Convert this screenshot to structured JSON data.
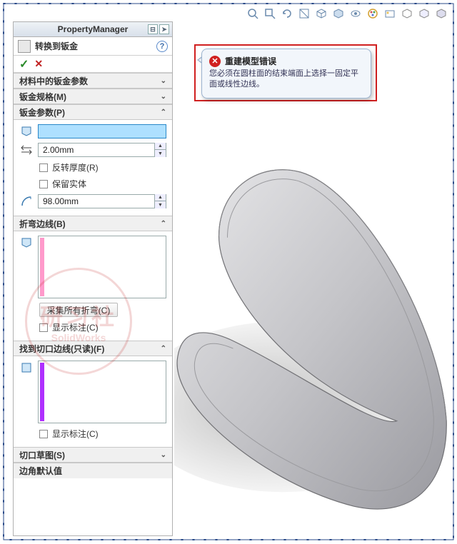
{
  "pm_title": "PropertyManager",
  "feature": {
    "title": "转换到钣金"
  },
  "buttons": {
    "ok": "✓",
    "cancel": "✕",
    "help": "?"
  },
  "sections": {
    "material": {
      "title": "材料中的钣金参数",
      "chev": "⌄"
    },
    "spec": {
      "title": "钣金规格(M)",
      "chev": "⌄"
    },
    "params": {
      "title": "钣金参数(P)",
      "chev": "⌃",
      "thickness": "2.00mm",
      "chk_reverse": "反转厚度(R)",
      "chk_keep": "保留实体",
      "radius": "98.00mm"
    },
    "bend": {
      "title": "折弯边线(B)",
      "chev": "⌃",
      "collect_btn": "采集所有折弯(C)",
      "chk_callout": "显示标注(C)"
    },
    "rip": {
      "title": "找到切口边线(只读)(F)",
      "chev": "⌃",
      "chk_callout": "显示标注(C)"
    },
    "sketch": {
      "title": "切口草图(S)",
      "chev": "⌄"
    },
    "corner": {
      "title": "边角默认值"
    }
  },
  "warning": {
    "title": "重建模型错误",
    "body": "您必须在圆柱面的结束端面上选择一固定平面或线性边线。"
  },
  "watermark": {
    "line1": "研习社",
    "line2": "SolidWorks"
  }
}
